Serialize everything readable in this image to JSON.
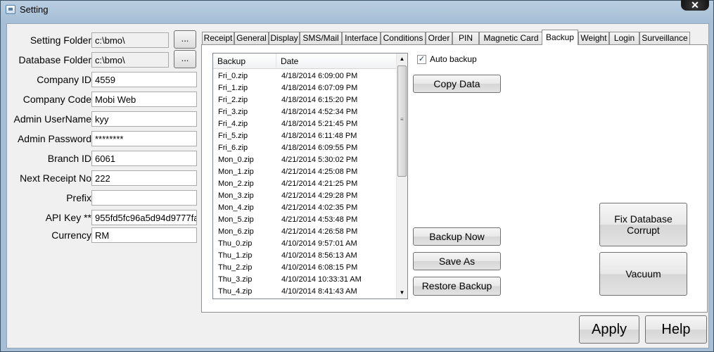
{
  "window": {
    "title": "Setting",
    "close_symbol": "✕"
  },
  "form": {
    "setting_folder": {
      "label": "Setting Folder",
      "value": "c:\\bmo\\",
      "browse": "..."
    },
    "database_folder": {
      "label": "Database Folder",
      "value": "c:\\bmo\\",
      "browse": "..."
    },
    "company_id": {
      "label": "Company ID",
      "value": "4559"
    },
    "company_code": {
      "label": "Company Code",
      "value": "Mobi Web"
    },
    "admin_username": {
      "label": "Admin UserName",
      "value": "kyy"
    },
    "admin_password": {
      "label": "Admin Password",
      "value": "********"
    },
    "branch_id": {
      "label": "Branch ID",
      "value": "6061"
    },
    "next_receipt_no": {
      "label": "Next Receipt No",
      "value": "222"
    },
    "prefix": {
      "label": "Prefix",
      "value": ""
    },
    "api_key": {
      "label": "API Key **",
      "value": "955fd5fc96a5d94d9777fa"
    },
    "currency": {
      "label": "Currency",
      "value": "RM"
    }
  },
  "tabs": [
    "Receipt",
    "General",
    "Display",
    "SMS/Mail",
    "Interface",
    "Conditions",
    "Order",
    "PIN",
    "Magnetic Card",
    "Backup",
    "Weight",
    "Login",
    "Surveillance"
  ],
  "active_tab": "Backup",
  "backup": {
    "columns": [
      "Backup",
      "Date"
    ],
    "rows": [
      [
        "Fri_0.zip",
        "4/18/2014 6:09:00 PM"
      ],
      [
        "Fri_1.zip",
        "4/18/2014 6:07:09 PM"
      ],
      [
        "Fri_2.zip",
        "4/18/2014 6:15:20 PM"
      ],
      [
        "Fri_3.zip",
        "4/18/2014 4:52:34 PM"
      ],
      [
        "Fri_4.zip",
        "4/18/2014 5:21:45 PM"
      ],
      [
        "Fri_5.zip",
        "4/18/2014 6:11:48 PM"
      ],
      [
        "Fri_6.zip",
        "4/18/2014 6:09:55 PM"
      ],
      [
        "Mon_0.zip",
        "4/21/2014 5:30:02 PM"
      ],
      [
        "Mon_1.zip",
        "4/21/2014 4:25:08 PM"
      ],
      [
        "Mon_2.zip",
        "4/21/2014 4:21:25 PM"
      ],
      [
        "Mon_3.zip",
        "4/21/2014 4:29:28 PM"
      ],
      [
        "Mon_4.zip",
        "4/21/2014 4:02:35 PM"
      ],
      [
        "Mon_5.zip",
        "4/21/2014 4:53:48 PM"
      ],
      [
        "Mon_6.zip",
        "4/21/2014 4:26:58 PM"
      ],
      [
        "Thu_0.zip",
        "4/10/2014 9:57:01 AM"
      ],
      [
        "Thu_1.zip",
        "4/10/2014 8:56:13 AM"
      ],
      [
        "Thu_2.zip",
        "4/10/2014 6:08:15 PM"
      ],
      [
        "Thu_3.zip",
        "4/10/2014 10:33:31 AM"
      ],
      [
        "Thu_4.zip",
        "4/10/2014 8:41:43 AM"
      ]
    ],
    "auto_backup_label": "Auto backup",
    "auto_backup_checked": true,
    "check_mark": "✓",
    "copy_data": "Copy Data",
    "backup_now": "Backup Now",
    "save_as": "Save As",
    "restore_backup": "Restore Backup",
    "fix_database": "Fix Database\nCorrupt",
    "vacuum": "Vacuum",
    "scroll_up": "▲",
    "scroll_down": "▼",
    "scroll_grip": "≡"
  },
  "footer": {
    "apply": "Apply",
    "help": "Help"
  }
}
